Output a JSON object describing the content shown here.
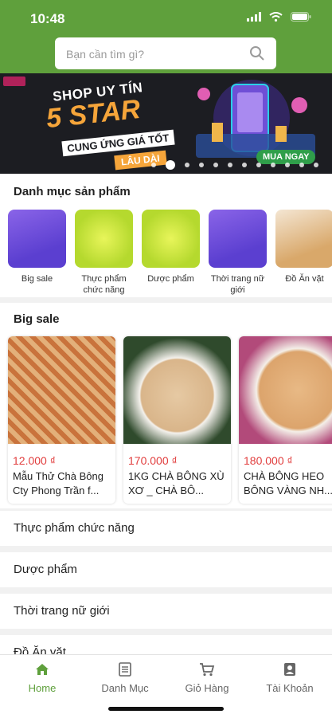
{
  "status_bar": {
    "time": "10:48"
  },
  "search": {
    "placeholder": "Bạn cần tìm gì?"
  },
  "banner": {
    "line1": "SHOP UY TÍN",
    "line2": "5 STAR",
    "line3": "CUNG ỨNG GIÁ TỐT",
    "line4": "LÂU DÀI",
    "cta": "MUA NGAY",
    "slide_count": 12,
    "active_slide": 2
  },
  "categories": {
    "title": "Danh mục sản phẩm",
    "items": [
      {
        "label": "Big sale"
      },
      {
        "label": "Thực phẩm chức năng"
      },
      {
        "label": "Dược phẩm"
      },
      {
        "label": "Thời trang nữ giới"
      },
      {
        "label": "Đồ Ăn vặt"
      }
    ]
  },
  "big_sale": {
    "title": "Big sale",
    "products": [
      {
        "price": "12.000 ₫",
        "name": "Mẫu Thử Chà Bông Cty Phong Trần f..."
      },
      {
        "price": "170.000 ₫",
        "name": "1KG CHÀ BÔNG XÙ XƠ _ CHÀ BÔ..."
      },
      {
        "price": "180.000 ₫",
        "name": "CHÀ BÔNG HEO BÔNG VÀNG NH..."
      }
    ]
  },
  "sections": [
    {
      "label": "Thực phẩm chức năng"
    },
    {
      "label": "Dược phẩm"
    },
    {
      "label": "Thời trang nữ giới"
    },
    {
      "label": "Đồ Ăn vặt"
    }
  ],
  "tabs": [
    {
      "label": "Home",
      "icon": "home-icon",
      "active": true
    },
    {
      "label": "Danh Mục",
      "icon": "list-icon",
      "active": false
    },
    {
      "label": "Giỏ Hàng",
      "icon": "cart-icon",
      "active": false
    },
    {
      "label": "Tài Khoản",
      "icon": "account-icon",
      "active": false
    }
  ],
  "colors": {
    "brand": "#5fa03c",
    "price": "#e13d3d",
    "banner_bg": "#1c1d22",
    "accent": "#f6a53a"
  }
}
